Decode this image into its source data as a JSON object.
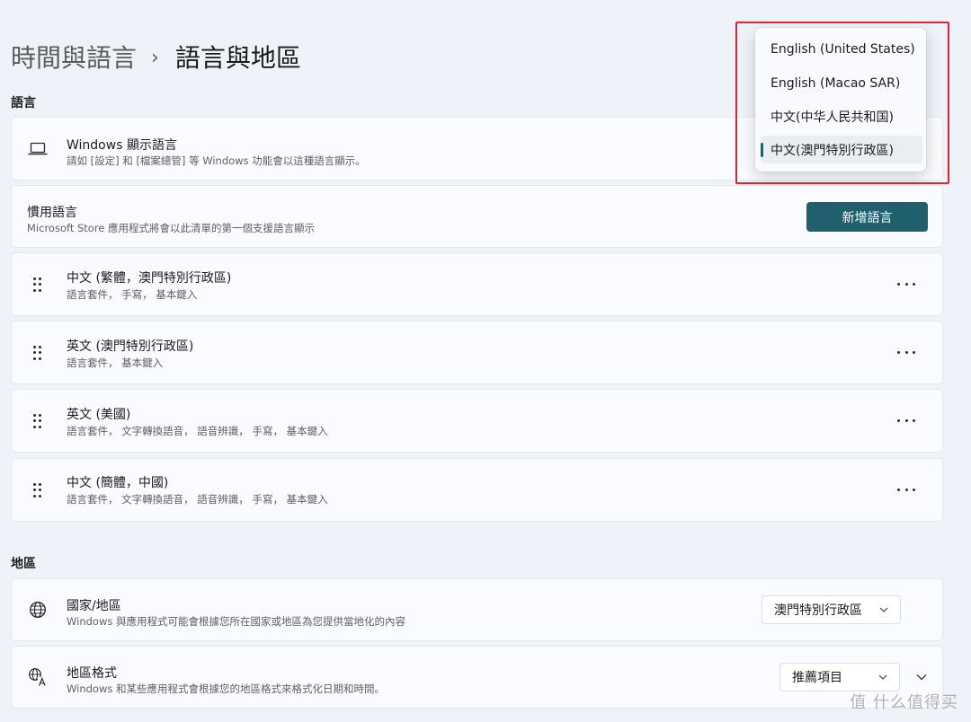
{
  "breadcrumb": {
    "parent": "時間與語言",
    "separator": "›",
    "current": "語言與地區"
  },
  "sections": {
    "language": "語言",
    "region": "地區"
  },
  "display_language": {
    "title": "Windows 顯示語言",
    "subtitle": "請如 [設定] 和 [檔案總管] 等 Windows 功能會以這種語言顯示。",
    "icon": "laptop-icon"
  },
  "preferred": {
    "title": "慣用語言",
    "subtitle": "Microsoft Store 應用程式將會以此清單的第一個支援語言顯示",
    "add_button": "新增語言"
  },
  "languages": [
    {
      "title": "中文 (繁體，澳門特別行政區)",
      "subtitle": "語言套件， 手寫， 基本鍵入"
    },
    {
      "title": "英文 (澳門特別行政區)",
      "subtitle": "語言套件， 基本鍵入"
    },
    {
      "title": "英文 (美國)",
      "subtitle": "語言套件， 文字轉換語音， 語音辨識， 手寫， 基本鍵入"
    },
    {
      "title": "中文 (簡體，中國)",
      "subtitle": "語言套件， 文字轉換語音， 語音辨識， 手寫， 基本鍵入"
    }
  ],
  "country": {
    "title": "國家/地區",
    "subtitle": "Windows 與應用程式可能會根據您所在國家或地區為您提供當地化的內容",
    "value": "澳門特別行政區",
    "icon": "globe-icon"
  },
  "regional_format": {
    "title": "地區格式",
    "subtitle": "Windows 和某些應用程式會根據您的地區格式來格式化日期和時間。",
    "value": "推薦項目",
    "icon": "language-format-icon"
  },
  "dropdown": {
    "options": [
      "English (United States)",
      "English (Macao SAR)",
      "中文(中华人民共和国)",
      "中文(澳門特別行政區)"
    ],
    "selected_index": 3
  },
  "watermark": "值 什么值得买",
  "colors": {
    "accent": "#1f5f6e",
    "highlight": "#e3242b"
  }
}
